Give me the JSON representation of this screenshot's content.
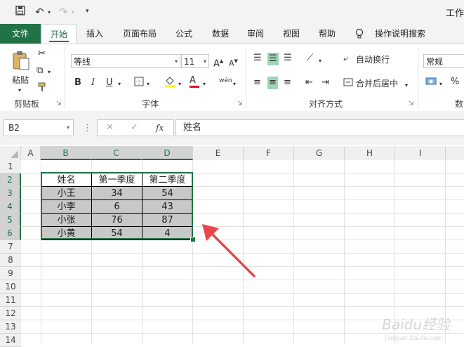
{
  "title_bar": {
    "doc_title": "工作"
  },
  "tabs": [
    {
      "label": "文件"
    },
    {
      "label": "开始"
    },
    {
      "label": "插入"
    },
    {
      "label": "页面布局"
    },
    {
      "label": "公式"
    },
    {
      "label": "数据"
    },
    {
      "label": "审阅"
    },
    {
      "label": "视图"
    },
    {
      "label": "帮助"
    },
    {
      "label": "操作说明搜索"
    }
  ],
  "ribbon": {
    "clipboard": {
      "paste_label": "粘贴",
      "group_label": "剪贴板"
    },
    "font": {
      "font_name": "等线",
      "font_size": "11",
      "bold": "B",
      "italic": "I",
      "underline": "U",
      "group_label": "字体",
      "font_size_up": "A",
      "font_size_down": "A",
      "font_color_letter": "A",
      "wen": "wén"
    },
    "alignment": {
      "wrap_text": "自动换行",
      "merge_center": "合并后居中",
      "group_label": "对齐方式"
    },
    "number": {
      "format": "常规",
      "percent": "%",
      "group_label": "数"
    }
  },
  "formula_bar": {
    "name_box": "B2",
    "fx": "fx",
    "content": "姓名"
  },
  "columns": [
    "A",
    "B",
    "C",
    "D",
    "E",
    "F",
    "G",
    "H",
    "I"
  ],
  "rows": [
    "1",
    "2",
    "3",
    "4",
    "5",
    "6",
    "7",
    "8",
    "9",
    "10",
    "11",
    "12",
    "13",
    "14"
  ],
  "table": {
    "headers": [
      "姓名",
      "第一季度",
      "第二季度"
    ],
    "rows": [
      [
        "小王",
        "34",
        "54"
      ],
      [
        "小李",
        "6",
        "43"
      ],
      [
        "小张",
        "76",
        "87"
      ],
      [
        "小黄",
        "54",
        "4"
      ]
    ]
  },
  "watermark": {
    "text": "Baidu经验",
    "sub": "jingyan.baidu.com"
  },
  "colors": {
    "accent": "#217346",
    "annotation_arrow": "#e8484a",
    "cell_shade": "#c8c8c8"
  }
}
